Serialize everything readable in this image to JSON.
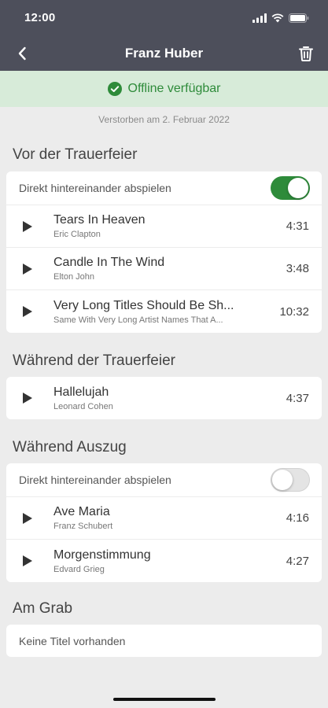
{
  "status": {
    "time": "12:00"
  },
  "nav": {
    "title": "Franz Huber"
  },
  "banner": {
    "text": "Offline verfügbar"
  },
  "subtitle": "Verstorben am 2. Februar 2022",
  "sections": [
    {
      "title": "Vor der Trauerfeier",
      "autoplay": {
        "label": "Direkt hintereinander abspielen",
        "on": true
      },
      "tracks": [
        {
          "title": "Tears In Heaven",
          "artist": "Eric Clapton",
          "duration": "4:31"
        },
        {
          "title": "Candle In The Wind",
          "artist": "Elton John",
          "duration": "3:48"
        },
        {
          "title": "Very Long Titles Should Be Sh...",
          "artist": "Same With Very Long Artist Names That A...",
          "duration": "10:32"
        }
      ]
    },
    {
      "title": "Während der Trauerfeier",
      "tracks": [
        {
          "title": "Hallelujah",
          "artist": "Leonard Cohen",
          "duration": "4:37"
        }
      ]
    },
    {
      "title": "Während Auszug",
      "autoplay": {
        "label": "Direkt hintereinander abspielen",
        "on": false
      },
      "tracks": [
        {
          "title": "Ave Maria",
          "artist": "Franz Schubert",
          "duration": "4:16"
        },
        {
          "title": "Morgenstimmung",
          "artist": "Edvard Grieg",
          "duration": "4:27"
        }
      ]
    },
    {
      "title": "Am Grab",
      "empty": "Keine Titel vorhanden"
    }
  ],
  "colors": {
    "header": "#4d4f5b",
    "accent": "#2e8b3a",
    "banner_bg": "#d7ebd9",
    "background": "#ececec"
  },
  "icons": {
    "back": "chevron-left-icon",
    "delete": "trash-icon",
    "offline": "check-circle-icon",
    "play": "play-icon"
  }
}
